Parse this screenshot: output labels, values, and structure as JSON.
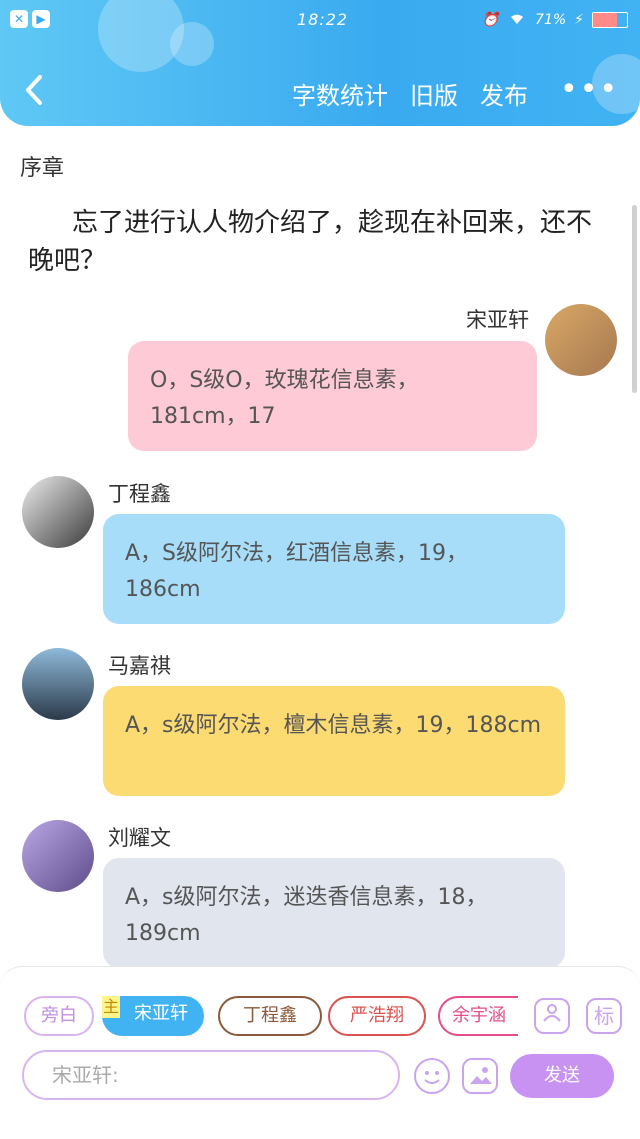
{
  "status_bar": {
    "time": "18:22",
    "battery": "71%"
  },
  "header": {
    "actions": [
      "字数统计",
      "旧版",
      "发布"
    ],
    "more": "•••"
  },
  "chapter_title": "序章",
  "intro_text": "忘了进行认人物介绍了，趁现在补回来，还不晚吧？",
  "messages": [
    {
      "name": "宋亚轩",
      "text": "O，S级O，玫瑰花信息素，181cm，17",
      "color": "#fdcad6"
    },
    {
      "name": "丁程鑫",
      "text": "A，S级阿尔法，红酒信息素，19，186cm",
      "color": "#a7ddf9"
    },
    {
      "name": "马嘉祺",
      "text": "A，s级阿尔法，檀木信息素，19，188cm",
      "color": "#fddb73"
    },
    {
      "name": "刘耀文",
      "text": "A，s级阿尔法，迷迭香信息素，18，189cm",
      "color": "#e0e5ee"
    }
  ],
  "bottom": {
    "chips": [
      {
        "label": "旁白"
      },
      {
        "label": "宋亚轩",
        "badge": "主"
      },
      {
        "label": "丁程鑫"
      },
      {
        "label": "严浩翔"
      },
      {
        "label": "余宇涵"
      }
    ],
    "tag_button": "标",
    "input_placeholder": "宋亚轩:",
    "send_label": "发送"
  }
}
